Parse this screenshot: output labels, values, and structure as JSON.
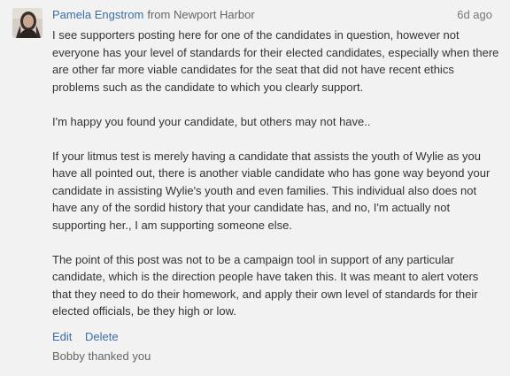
{
  "comment": {
    "author": "Pamela Engstrom",
    "from_label": "from",
    "location": "Newport Harbor",
    "timestamp": "6d ago",
    "paragraphs": [
      "I see supporters posting here for one of the candidates in question, however not everyone has your level of standards for their elected candidates, especially when there are other far more viable candidates for the seat that did not have recent ethics problems such as the candidate to which you clearly support.",
      "I'm happy you found your candidate, but others may not have..",
      "If your litmus test is merely having a candidate that assists the youth of Wylie as you have all pointed out, there is another viable candidate who has gone way beyond your candidate in assisting Wylie's youth and even families. This individual also does not have any of the sordid history that your candidate has, and no, I'm actually not supporting her., I am supporting someone else.",
      "The point of this post was not to be a campaign tool in support of any particular candidate, which is the direction people have taken this. It was meant to alert voters that they need to do their homework, and apply their own level of standards for their elected officials, be they high or low."
    ],
    "actions": {
      "edit_label": "Edit",
      "delete_label": "Delete"
    },
    "thanked_text": "Bobby thanked you",
    "colors": {
      "link": "#3b6ea5",
      "text": "#333333",
      "meta": "#666666",
      "background": "#f2f2f2"
    }
  }
}
